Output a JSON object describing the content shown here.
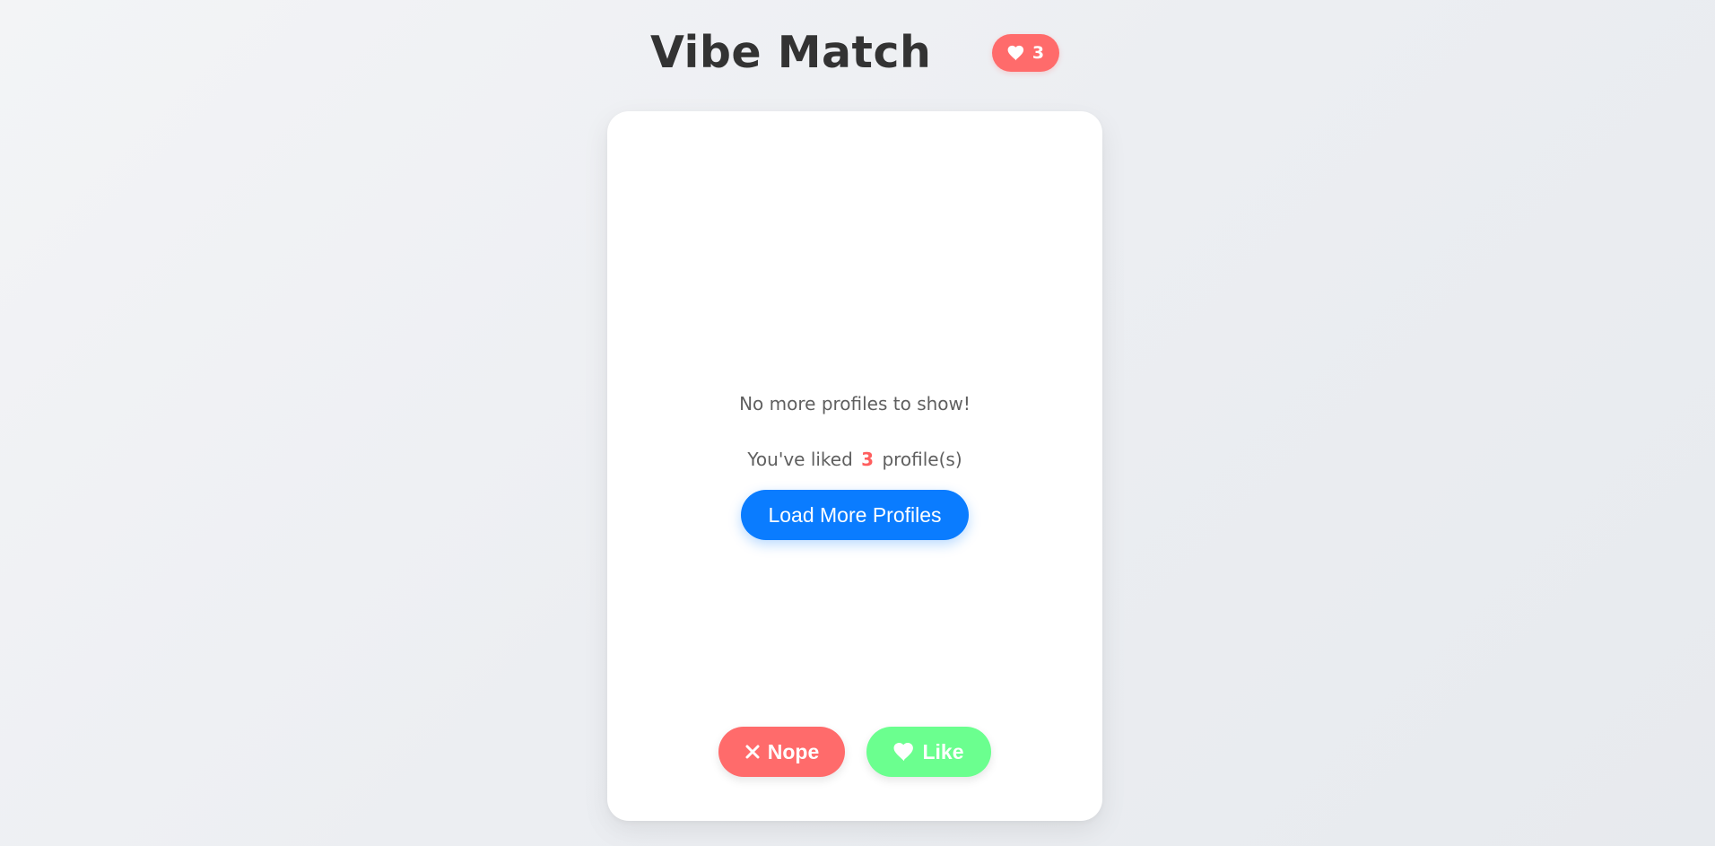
{
  "header": {
    "title": "Vibe Match",
    "likes_badge": {
      "count": "3",
      "icon": "heart-icon"
    }
  },
  "card": {
    "empty_message": "No more profiles to show!",
    "liked_prefix": "You've liked",
    "liked_count": "3",
    "liked_suffix": "profile(s)",
    "load_more_label": "Load More Profiles"
  },
  "actions": {
    "nope": {
      "label": "Nope",
      "icon": "close-icon",
      "color": "#ff6b6b"
    },
    "like": {
      "label": "Like",
      "icon": "heart-icon",
      "color": "#6bff8f"
    }
  },
  "colors": {
    "accent_red": "#ff6b6b",
    "accent_blue": "#0a7cff",
    "accent_green": "#6bff8f",
    "title_text": "#333333",
    "body_text": "#5f5f5f"
  }
}
